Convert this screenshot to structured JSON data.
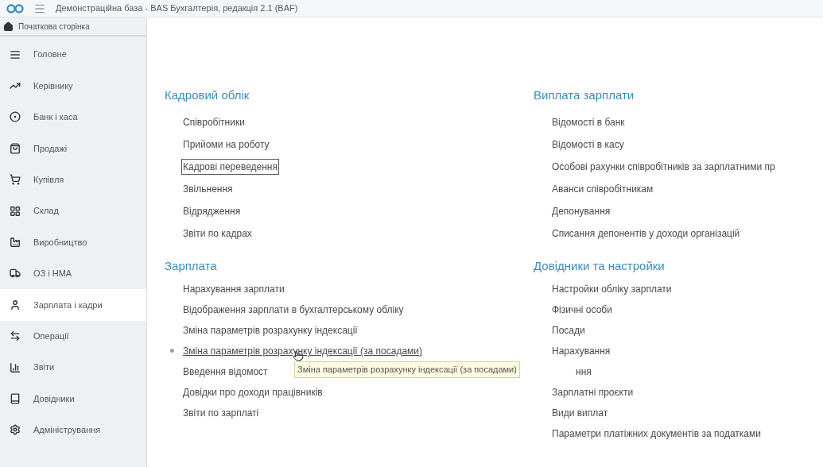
{
  "window": {
    "title": "Демонстраційна база - BAS Бухгалтерія, редакція 2.1  (BAF)"
  },
  "home_tab": {
    "label": "Початкова сторінка"
  },
  "sidebar": {
    "items": [
      {
        "label": "Головне",
        "selected": false
      },
      {
        "label": "Керівнику",
        "selected": false
      },
      {
        "label": "Банк і каса",
        "selected": false
      },
      {
        "label": "Продажі",
        "selected": false
      },
      {
        "label": "Купівля",
        "selected": false
      },
      {
        "label": "Склад",
        "selected": false
      },
      {
        "label": "Виробництво",
        "selected": false
      },
      {
        "label": "ОЗ і НМА",
        "selected": false
      },
      {
        "label": "Зарплата і кадри",
        "selected": true
      },
      {
        "label": "Операції",
        "selected": false
      },
      {
        "label": "Звіти",
        "selected": false
      },
      {
        "label": "Довідники",
        "selected": false
      },
      {
        "label": "Адміністрування",
        "selected": false
      }
    ]
  },
  "sections": [
    {
      "title": "Кадровий облік",
      "items": [
        {
          "label": "Співробітники",
          "focused": false,
          "hovered": false
        },
        {
          "label": "Прийоми на роботу",
          "focused": false,
          "hovered": false
        },
        {
          "label": "Кадрові переведення",
          "focused": true,
          "hovered": false
        },
        {
          "label": "Звільнення",
          "focused": false,
          "hovered": false
        },
        {
          "label": "Відрядження",
          "focused": false,
          "hovered": false
        },
        {
          "label": "Звіти по кадрах",
          "focused": false,
          "hovered": false
        }
      ]
    },
    {
      "title": "Виплата зарплати",
      "items": [
        {
          "label": "Відомості в банк",
          "focused": false,
          "hovered": false
        },
        {
          "label": "Відомості в касу",
          "focused": false,
          "hovered": false
        },
        {
          "label": "Особові рахунки співробітників за зарплатними пр",
          "focused": false,
          "hovered": false
        },
        {
          "label": "Аванси співробітникам",
          "focused": false,
          "hovered": false
        },
        {
          "label": "Депонування",
          "focused": false,
          "hovered": false
        },
        {
          "label": "Списання депонентів у доходи організацій",
          "focused": false,
          "hovered": false
        }
      ]
    },
    {
      "title": "Зарплата",
      "items": [
        {
          "label": "Нарахування зарплати",
          "focused": false,
          "hovered": false
        },
        {
          "label": "Відображення зарплати в бухгалтерському обліку",
          "focused": false,
          "hovered": false
        },
        {
          "label": "Зміна параметрів розрахунку індексації",
          "focused": false,
          "hovered": false
        },
        {
          "label": "Зміна параметрів розрахунку індексації (за посадами)",
          "focused": false,
          "hovered": true
        },
        {
          "label": "Введення відомост",
          "focused": false,
          "hovered": false
        },
        {
          "label": "Довідки про доходи працівників",
          "focused": false,
          "hovered": false
        },
        {
          "label": "Звіти по зарплаті",
          "focused": false,
          "hovered": false
        }
      ]
    },
    {
      "title": "Довідники та настройки",
      "items": [
        {
          "label": "Настройки обліку зарплати",
          "focused": false,
          "hovered": false
        },
        {
          "label": "Фізичні особи",
          "focused": false,
          "hovered": false
        },
        {
          "label": "Посади",
          "focused": false,
          "hovered": false
        },
        {
          "label": "Нарахування",
          "focused": false,
          "hovered": false
        },
        {
          "label": "ння",
          "focused": false,
          "hovered": false
        },
        {
          "label": "Зарплатні проєкти",
          "focused": false,
          "hovered": false
        },
        {
          "label": "Види виплат",
          "focused": false,
          "hovered": false
        },
        {
          "label": "Параметри платіжних документів за податками",
          "focused": false,
          "hovered": false
        }
      ]
    }
  ],
  "tooltip": {
    "text": "Зміна параметрів розрахунку індексації (за посадами)"
  }
}
